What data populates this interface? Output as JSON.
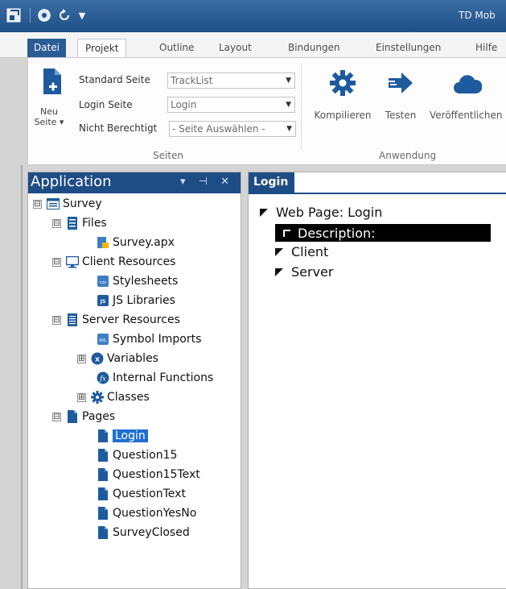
{
  "titlebar": {
    "app_title": "TD Mob",
    "qa_more": "▼"
  },
  "ribbon_tabs": [
    {
      "label": "Datei"
    },
    {
      "label": "Projekt"
    },
    {
      "label": "Outline"
    },
    {
      "label": "Layout"
    },
    {
      "label": "Bindungen"
    },
    {
      "label": "Einstellungen"
    },
    {
      "label": "Hilfe"
    }
  ],
  "seiten_group": {
    "group_label": "Seiten",
    "neu_button_label": "Neu Seite ▾",
    "fields": [
      {
        "label": "Standard Seite",
        "value": "TrackList"
      },
      {
        "label": "Login Seite",
        "value": "Login"
      },
      {
        "label": "Nicht Berechtigt",
        "value": "- Seite Auswählen -"
      }
    ]
  },
  "anwendung_group": {
    "group_label": "Anwendung",
    "buttons": [
      {
        "label": "Kompilieren",
        "icon": "gear-icon"
      },
      {
        "label": "Testen",
        "icon": "arrow-right-icon"
      },
      {
        "label": "Veröffentlichen",
        "icon": "cloud-icon"
      }
    ]
  },
  "application_panel": {
    "title": "Application",
    "controls": "▾ ⊣ ✕",
    "tree": [
      {
        "label": "Survey",
        "expander": "⊟",
        "icon": "project-icon"
      },
      {
        "label": "Files",
        "expander": "⊟",
        "icon": "files-icon"
      },
      {
        "label": "Survey.apx",
        "icon": "apx-file-icon"
      },
      {
        "label": "Client Resources",
        "expander": "⊟",
        "icon": "monitor-icon"
      },
      {
        "label": "Stylesheets",
        "icon": "css-icon"
      },
      {
        "label": "JS Libraries",
        "icon": "js-icon"
      },
      {
        "label": "Server Resources",
        "expander": "⊟",
        "icon": "server-doc-icon"
      },
      {
        "label": "Symbol Imports",
        "icon": "axl-icon"
      },
      {
        "label": "Variables",
        "expander": "⊞",
        "icon": "variable-icon"
      },
      {
        "label": "Internal Functions",
        "icon": "function-icon"
      },
      {
        "label": "Classes",
        "expander": "⊞",
        "icon": "class-gear-icon"
      },
      {
        "label": "Pages",
        "expander": "⊟",
        "icon": "pages-icon"
      },
      {
        "label": "Login",
        "icon": "page-icon",
        "selected": true
      },
      {
        "label": "Question15",
        "icon": "page-icon"
      },
      {
        "label": "Question15Text",
        "icon": "page-icon"
      },
      {
        "label": "QuestionText",
        "icon": "page-icon"
      },
      {
        "label": "QuestionYesNo",
        "icon": "page-icon"
      },
      {
        "label": "SurveyClosed",
        "icon": "page-icon"
      }
    ]
  },
  "editor": {
    "tab_label": "Login",
    "lines": [
      {
        "text": "Web Page: Login"
      },
      {
        "text": "Description:",
        "highlighted": true
      },
      {
        "text": "Client"
      },
      {
        "text": "Server"
      }
    ]
  }
}
